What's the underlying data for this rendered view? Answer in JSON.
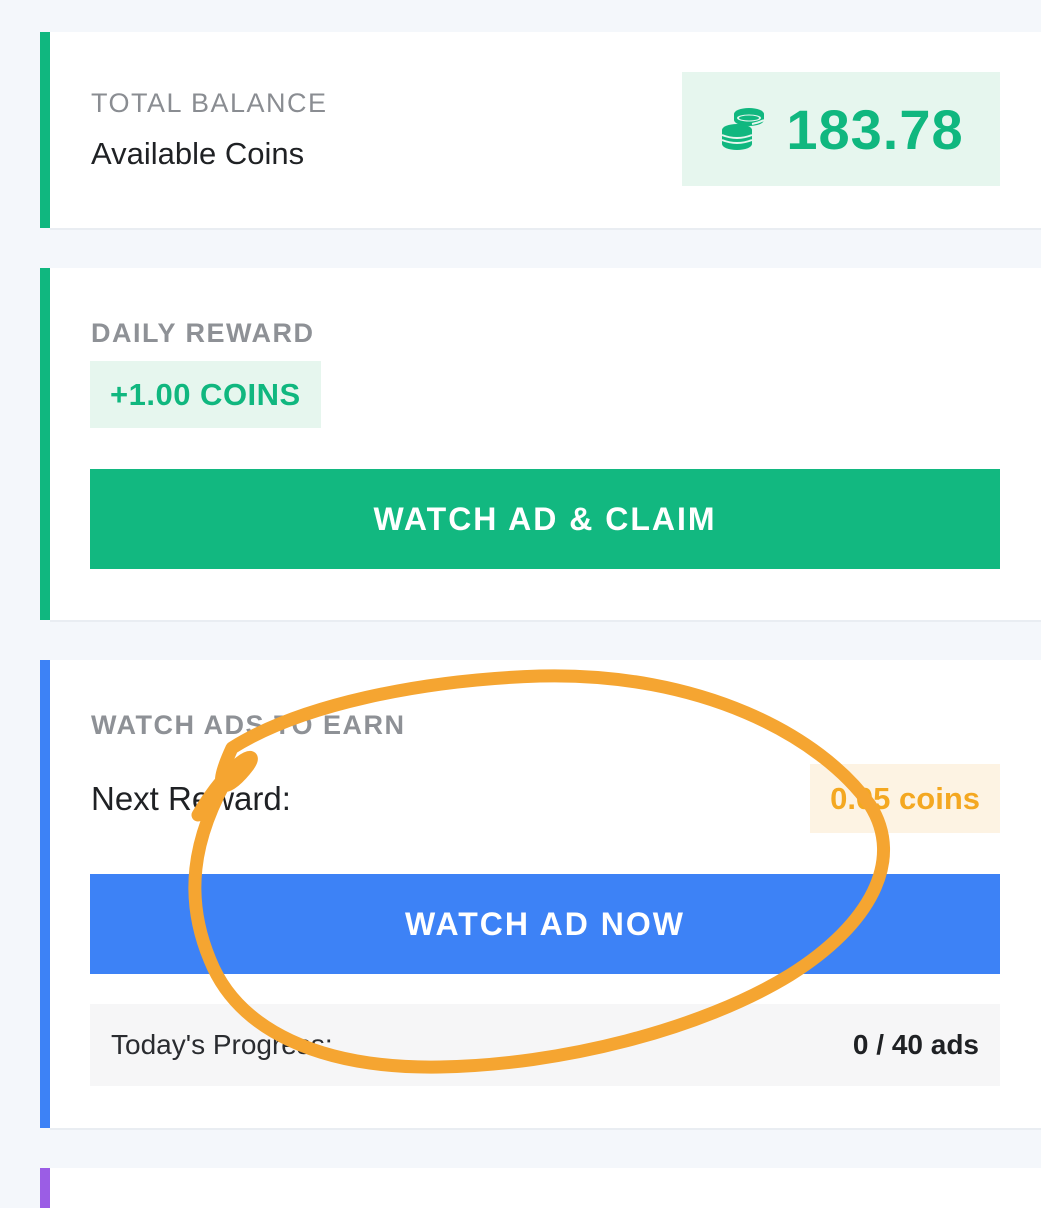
{
  "balance_card": {
    "label": "TOTAL BALANCE",
    "subtitle": "Available Coins",
    "amount": "183.78",
    "icon": "coins-stack-icon"
  },
  "daily_card": {
    "label": "DAILY REWARD",
    "reward": "+1.00 COINS",
    "button_label": "WATCH AD & CLAIM"
  },
  "ads_card": {
    "label": "WATCH ADS TO EARN",
    "next_reward_label": "Next Reward:",
    "next_reward_value": "0.05 coins",
    "button_label": "WATCH AD NOW",
    "progress_label": "Today's Progress:",
    "progress_value": "0 / 40 ads",
    "progress_done": 0,
    "progress_total": 40
  },
  "colors": {
    "green": "#10b77f",
    "blue": "#3d82f6",
    "orange": "#f4a821",
    "purple": "#9b5de5",
    "annotation": "#f5a531"
  }
}
